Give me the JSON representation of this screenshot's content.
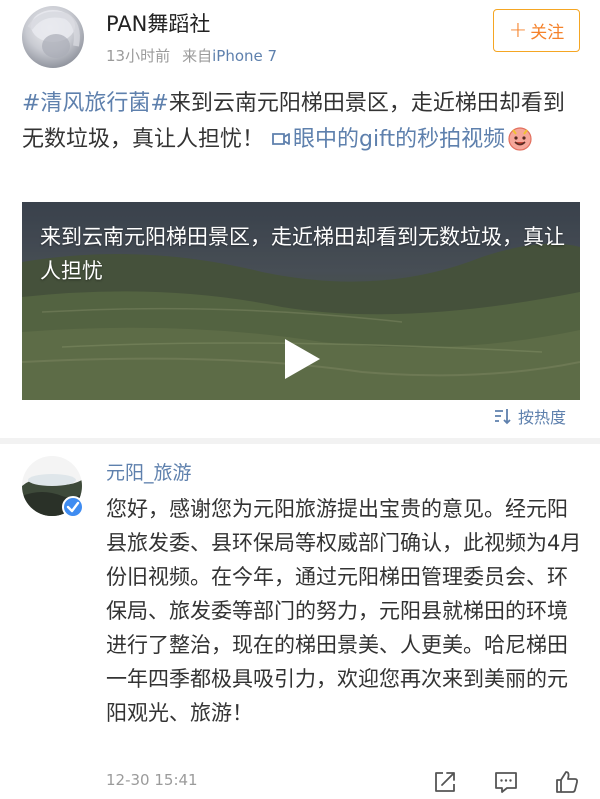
{
  "post": {
    "username": "PAN舞蹈社",
    "time": "13小时前",
    "source_prefix": "来自",
    "device": "iPhone 7",
    "follow_plus": "+",
    "follow_label": "关注",
    "hashtag": "#清风旅行菌#",
    "text": "来到云南元阳梯田景区，走近梯田却看到无数垃圾，真让人担忧！",
    "link_text": "眼中的gift的秒拍视频",
    "link_icon": "video-link-icon",
    "emoji": "smiling-face-emoji"
  },
  "video": {
    "caption": "来到云南元阳梯田景区，走近梯田却看到无数垃圾，真让人担忧",
    "play_icon": "play-icon"
  },
  "sort": {
    "label": "按热度",
    "icon": "sort-icon"
  },
  "comment": {
    "username": "元阳_旅游",
    "verified_icon": "verified-badge-icon",
    "text": "您好，感谢您为元阳旅游提出宝贵的意见。经元阳县旅发委、县环保局等权威部门确认，此视频为4月份旧视频。在今年，通过元阳梯田管理委员会、环保局、旅发委等部门的努力，元阳县就梯田的环境进行了整治，现在的梯田景美、人更美。哈尼梯田一年四季都极具吸引力，欢迎您再次来到美丽的元阳观光、旅游！",
    "time": "12-30 15:41",
    "actions": [
      "share-icon",
      "comment-icon",
      "like-icon"
    ]
  },
  "colors": {
    "link": "#5e80ad",
    "follow": "#f5822b",
    "text": "#333333",
    "meta": "#9b9b9b"
  }
}
